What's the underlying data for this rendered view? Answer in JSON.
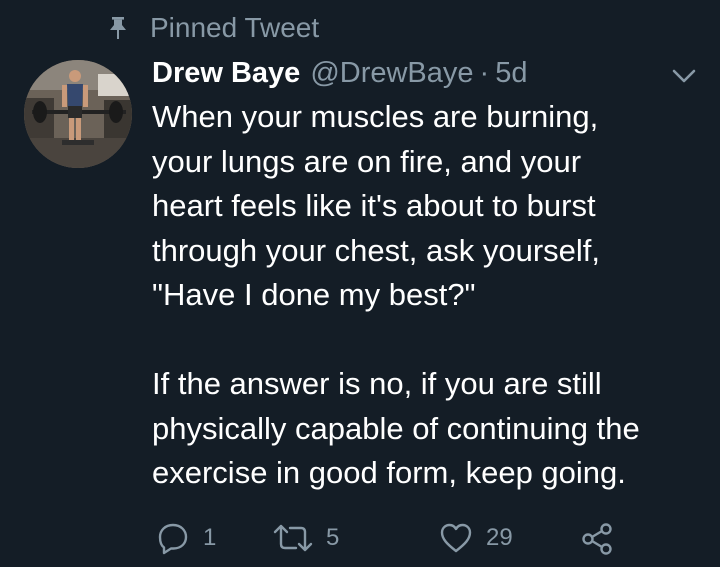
{
  "pinned": {
    "label": "Pinned Tweet",
    "icon": "pin-icon"
  },
  "tweet": {
    "author": {
      "name": "Drew Baye",
      "handle": "@DrewBaye",
      "avatar_icon": "avatar"
    },
    "separator": "·",
    "time": "5d",
    "text": "When your muscles are burning,\nyour lungs are on fire, and your\nheart feels like it's about to burst\nthrough your chest, ask yourself,\n\"Have I done my best?\"\n\nIf the answer is no, if you are still\nphysically capable of continuing the\nexercise in good form, keep going.",
    "actions": {
      "reply": {
        "icon": "reply-icon",
        "count": "1"
      },
      "retweet": {
        "icon": "retweet-icon",
        "count": "5"
      },
      "like": {
        "icon": "heart-icon",
        "count": "29"
      },
      "share": {
        "icon": "share-icon"
      }
    }
  },
  "colors": {
    "background": "#141d26",
    "primary_text": "#ffffff",
    "secondary_text": "#8899a6"
  }
}
